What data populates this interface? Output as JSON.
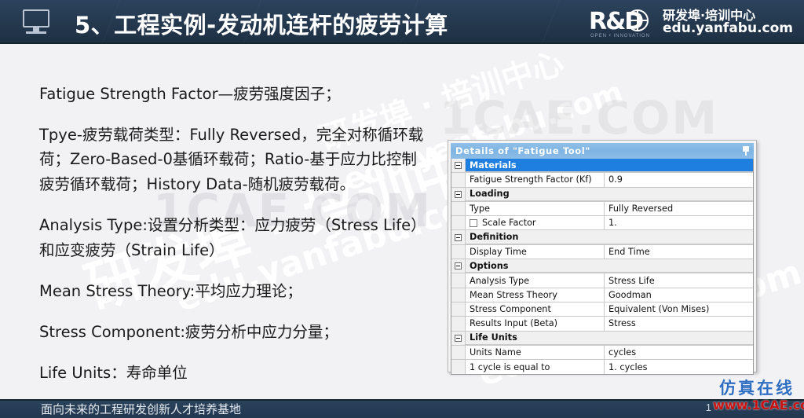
{
  "header": {
    "title": "5、工程实例-发动机连杆的疲劳计算",
    "monitor_icon": "monitor-icon",
    "logo": {
      "mark": "R&D",
      "tagline": "OPEN  •  INNOVATION",
      "cn_name": "研发埠·培训中心",
      "url": "edu.yanfabu.com"
    }
  },
  "content": {
    "paragraphs": [
      "Fatigue Strength Factor—疲劳强度因子；",
      "Tpye-疲劳载荷类型：Fully Reversed，完全对称循环载荷；Zero-Based-0基循环载荷；Ratio-基于应力比控制疲劳循环载荷；History Data-随机疲劳载荷。",
      "Analysis Type:设置分析类型：应力疲劳（Stress Life）和应变疲劳（Strain Life）",
      "Mean Stress Theory:平均应力理论；",
      "Stress Component:疲劳分析中应力分量；",
      "Life Units：寿命单位"
    ]
  },
  "details_panel": {
    "title": "Details of \"Fatigue Tool\"",
    "pin_icon": "pin-icon",
    "rows": [
      {
        "type": "group",
        "label": "Materials",
        "value": "",
        "selected": true
      },
      {
        "type": "item",
        "label": "Fatigue Strength Factor (Kf)",
        "value": "0.9"
      },
      {
        "type": "group",
        "label": "Loading",
        "value": ""
      },
      {
        "type": "item",
        "label": "Type",
        "value": "Fully Reversed"
      },
      {
        "type": "check",
        "label": "Scale Factor",
        "value": "1."
      },
      {
        "type": "group",
        "label": "Definition",
        "value": ""
      },
      {
        "type": "item",
        "label": "Display Time",
        "value": "End Time"
      },
      {
        "type": "group",
        "label": "Options",
        "value": ""
      },
      {
        "type": "item",
        "label": "Analysis Type",
        "value": "Stress Life"
      },
      {
        "type": "item",
        "label": "Mean Stress Theory",
        "value": "Goodman"
      },
      {
        "type": "item",
        "label": "Stress Component",
        "value": "Equivalent (Von Mises)"
      },
      {
        "type": "item",
        "label": "Results Input (Beta)",
        "value": "Stress"
      },
      {
        "type": "group",
        "label": "Life Units",
        "value": ""
      },
      {
        "type": "item",
        "label": "Units Name",
        "value": "cycles"
      },
      {
        "type": "item",
        "label": "1 cycle is equal to",
        "value": "1. cycles"
      }
    ]
  },
  "watermarks": {
    "brand_cn": "研发埠 · 培训中心",
    "brand_url": "edu.yanfabu.com",
    "cae": "1CAE.COM"
  },
  "footer": {
    "text": "面向未来的工程研发创新人才培养基地",
    "page": "1"
  },
  "cae_badge": {
    "cn": "仿真在线",
    "url": "www.1CAE.com"
  },
  "colors": {
    "header_bg": "#24384e",
    "slide_bg": "#f2f1f3",
    "panel_title_bg": "#8fc0e8",
    "selected_row_bg": "#1f7fe0",
    "cae_blue": "#2f6fc2",
    "cae_red": "#cc1111"
  }
}
